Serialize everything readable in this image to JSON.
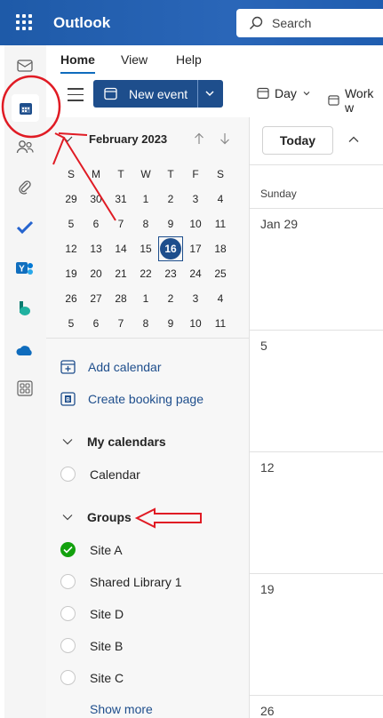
{
  "app": {
    "title": "Outlook",
    "search_label": "Search"
  },
  "ribbon": {
    "tabs": [
      "Home",
      "View",
      "Help"
    ],
    "new_event_label": "New event",
    "view_label": "Day",
    "work_week_label": "Work w"
  },
  "mini_calendar": {
    "month_label": "February 2023",
    "weekday_headers": [
      "S",
      "M",
      "T",
      "W",
      "T",
      "F",
      "S"
    ],
    "weeks": [
      [
        "29",
        "30",
        "31",
        "1",
        "2",
        "3",
        "4"
      ],
      [
        "5",
        "6",
        "7",
        "8",
        "9",
        "10",
        "11"
      ],
      [
        "12",
        "13",
        "14",
        "15",
        "16",
        "17",
        "18"
      ],
      [
        "19",
        "20",
        "21",
        "22",
        "23",
        "24",
        "25"
      ],
      [
        "26",
        "27",
        "28",
        "1",
        "2",
        "3",
        "4"
      ],
      [
        "5",
        "6",
        "7",
        "8",
        "9",
        "10",
        "11"
      ]
    ],
    "today": "16"
  },
  "sidebar": {
    "add_calendar": "Add calendar",
    "create_booking": "Create booking page",
    "my_calendars_title": "My calendars",
    "my_calendars": [
      "Calendar"
    ],
    "groups_title": "Groups",
    "groups": [
      {
        "name": "Site A",
        "checked": true
      },
      {
        "name": "Shared Library 1",
        "checked": false
      },
      {
        "name": "Site D",
        "checked": false
      },
      {
        "name": "Site B",
        "checked": false
      },
      {
        "name": "Site C",
        "checked": false
      }
    ],
    "show_more": "Show more"
  },
  "main": {
    "today_label": "Today",
    "day_header": "Sunday",
    "week_labels": [
      "Jan 29",
      "5",
      "12",
      "19",
      "26"
    ]
  },
  "colors": {
    "topbar": "#1e5aa8",
    "accent": "#1e4e8c",
    "annotation": "#e01b24",
    "check_green": "#13a10e"
  }
}
